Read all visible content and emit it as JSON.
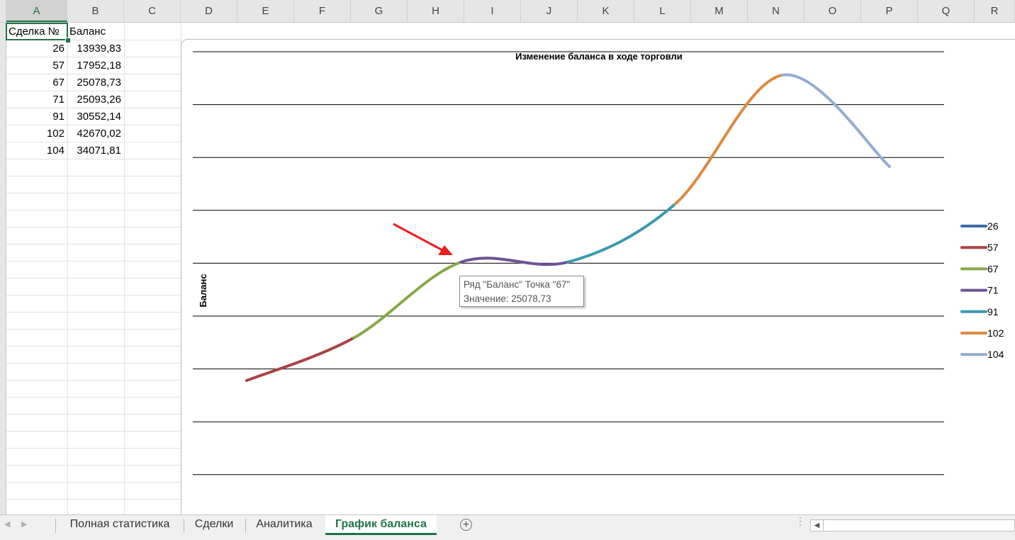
{
  "columns": [
    "A",
    "B",
    "C",
    "D",
    "E",
    "F",
    "G",
    "H",
    "I",
    "J",
    "K",
    "L",
    "M",
    "N",
    "O",
    "P",
    "Q",
    "R"
  ],
  "table": {
    "header": {
      "col_a": "Сделка №",
      "col_b": "Баланс"
    },
    "rows": [
      {
        "deal": "26",
        "balance": "13939,83"
      },
      {
        "deal": "57",
        "balance": "17952,18"
      },
      {
        "deal": "67",
        "balance": "25078,73"
      },
      {
        "deal": "71",
        "balance": "25093,26"
      },
      {
        "deal": "91",
        "balance": "30552,14"
      },
      {
        "deal": "102",
        "balance": "42670,02"
      },
      {
        "deal": "104",
        "balance": "34071,81"
      }
    ]
  },
  "chart_data": {
    "type": "line",
    "title": "Изменение баланса в ходе торговли",
    "ylabel": "Баланс",
    "xlabel": "",
    "smooth": true,
    "grid": true,
    "legend_position": "right",
    "categories": [
      "26",
      "57",
      "67",
      "71",
      "91",
      "102",
      "104"
    ],
    "values": [
      13939.83,
      17952.18,
      25078.73,
      25093.26,
      30552.14,
      42670.02,
      34071.81
    ],
    "segment_colors": [
      "#3e6aa6",
      "#a84442",
      "#86a84a",
      "#6e5394",
      "#3c98ad",
      "#db8a43",
      "#93acd1"
    ],
    "legend": [
      "26",
      "57",
      "67",
      "71",
      "91",
      "102",
      "104"
    ]
  },
  "tooltip": {
    "line1": "Ряд \"Баланс\" Точка \"67\"",
    "line2": "Значение: 25078,73"
  },
  "annotation": {
    "arrow_color": "#e82020"
  },
  "sheets": {
    "tabs": [
      "Полная статистика",
      "Сделки",
      "Аналитика",
      "График баланса"
    ],
    "active": "График баланса",
    "add_symbol": "+"
  }
}
